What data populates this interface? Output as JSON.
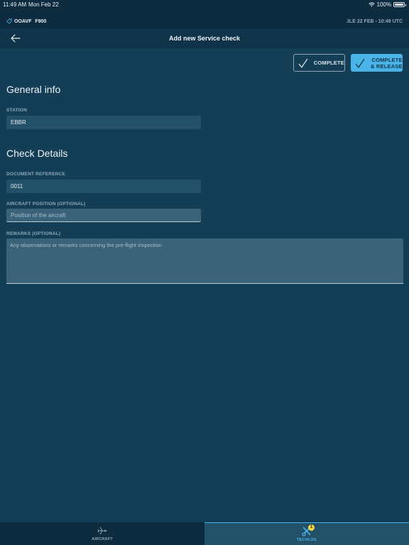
{
  "status_bar": {
    "time": "11:49 AM",
    "date": "Mon Feb 22",
    "battery": "100%",
    "icons": [
      "wifi-icon",
      "battery-icon"
    ]
  },
  "aircraft_bar": {
    "aircraft": "OOAVF",
    "type": "F900",
    "icon": "tag-icon",
    "utc_info": "JLE 22 FEB - 10:49 UTC"
  },
  "nav": {
    "back_icon": "arrow-left-icon",
    "title": "Add new Service check"
  },
  "actions": {
    "complete_label": "COMPLETE",
    "release_line1": "COMPLETE",
    "release_line2": "& RELEASE",
    "accent": "#4ab4e8"
  },
  "general_info": {
    "title": "General info",
    "station_label": "STATION",
    "station_value": "EBBR"
  },
  "check_details": {
    "title": "Check Details",
    "doc_ref_label": "DOCUMENT REFERENCE",
    "doc_ref_value": "0011",
    "position_label": "AIRCRAFT POSITION (OPTIONAL)",
    "position_placeholder": "Position of the aircraft",
    "remarks_label": "REMARKS (OPTIONAL)",
    "remarks_placeholder": "Any observations or remarks concerning the pre-flight inspection"
  },
  "tabs": [
    {
      "label": "AIRCRAFT",
      "icon": "airplane-icon",
      "active": false
    },
    {
      "label": "TECHLOG",
      "icon": "tools-icon",
      "active": true,
      "badge": "1"
    }
  ]
}
